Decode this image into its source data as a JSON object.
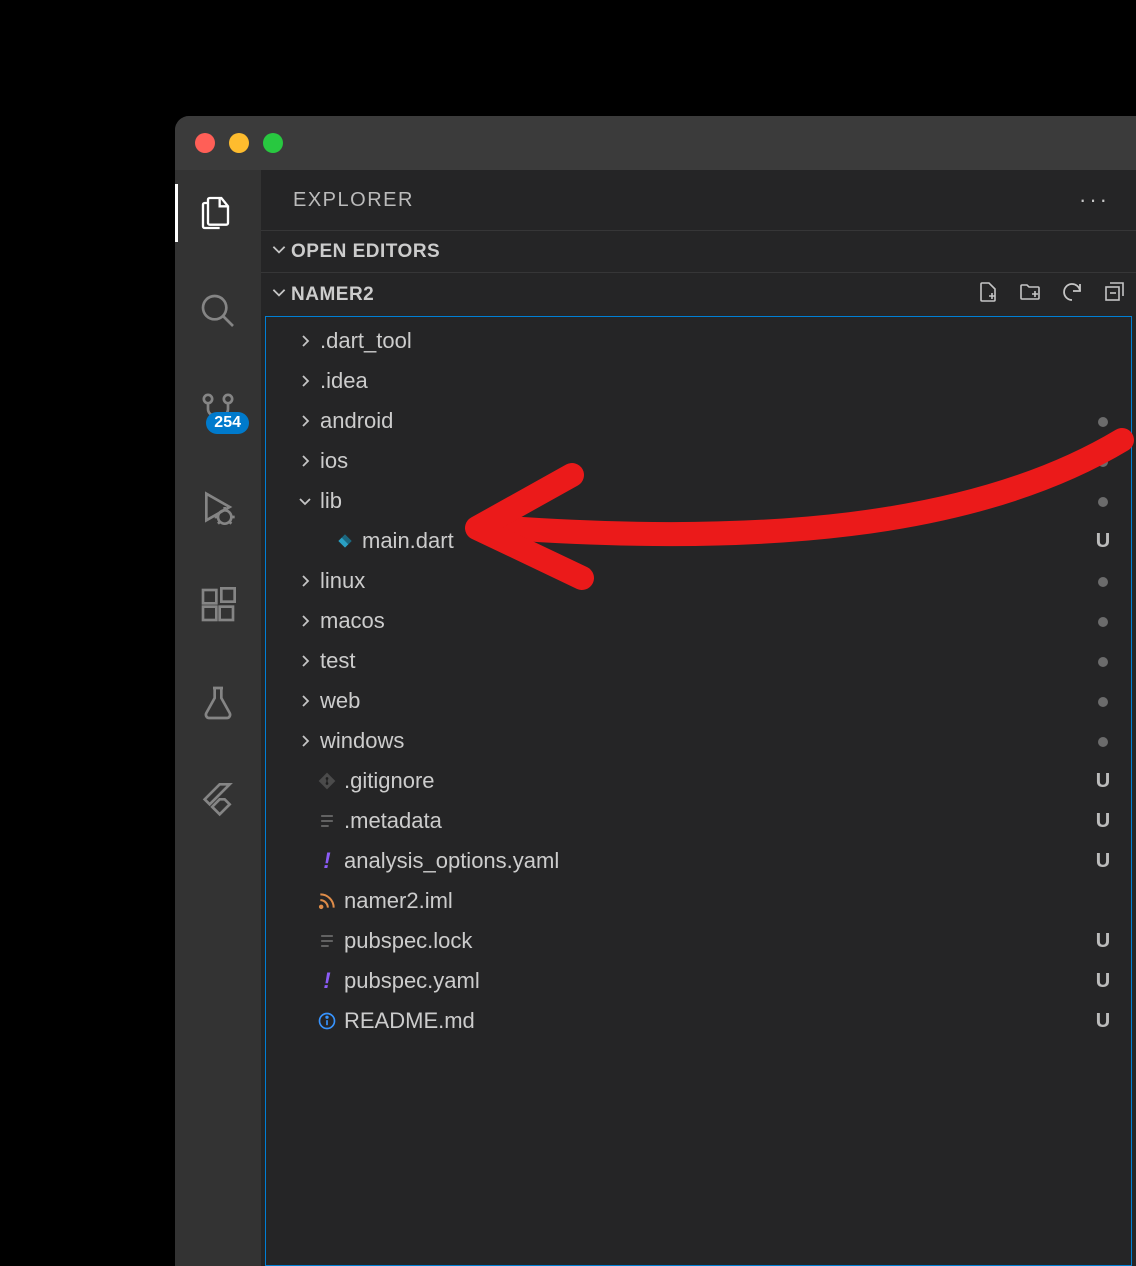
{
  "explorer": {
    "title": "EXPLORER"
  },
  "sections": {
    "open_editors": "OPEN EDITORS",
    "workspace": "NAMER2"
  },
  "activity": {
    "scm_badge": "254"
  },
  "tree": [
    {
      "type": "folder",
      "name": ".dart_tool",
      "expanded": false,
      "status": ""
    },
    {
      "type": "folder",
      "name": ".idea",
      "expanded": false,
      "status": ""
    },
    {
      "type": "folder",
      "name": "android",
      "expanded": false,
      "status": "dot"
    },
    {
      "type": "folder",
      "name": "ios",
      "expanded": false,
      "status": "dot"
    },
    {
      "type": "folder",
      "name": "lib",
      "expanded": true,
      "status": "dot"
    },
    {
      "type": "file",
      "name": "main.dart",
      "icon": "dart",
      "indent": 2,
      "status": "U"
    },
    {
      "type": "folder",
      "name": "linux",
      "expanded": false,
      "status": "dot"
    },
    {
      "type": "folder",
      "name": "macos",
      "expanded": false,
      "status": "dot"
    },
    {
      "type": "folder",
      "name": "test",
      "expanded": false,
      "status": "dot"
    },
    {
      "type": "folder",
      "name": "web",
      "expanded": false,
      "status": "dot"
    },
    {
      "type": "folder",
      "name": "windows",
      "expanded": false,
      "status": "dot"
    },
    {
      "type": "file",
      "name": ".gitignore",
      "icon": "git",
      "indent": 1,
      "status": "U"
    },
    {
      "type": "file",
      "name": ".metadata",
      "icon": "lines",
      "indent": 1,
      "status": "U"
    },
    {
      "type": "file",
      "name": "analysis_options.yaml",
      "icon": "excl",
      "indent": 1,
      "status": "U"
    },
    {
      "type": "file",
      "name": "namer2.iml",
      "icon": "rss",
      "indent": 1,
      "status": ""
    },
    {
      "type": "file",
      "name": "pubspec.lock",
      "icon": "lines",
      "indent": 1,
      "status": "U"
    },
    {
      "type": "file",
      "name": "pubspec.yaml",
      "icon": "excl",
      "indent": 1,
      "status": "U"
    },
    {
      "type": "file",
      "name": "README.md",
      "icon": "info",
      "indent": 1,
      "status": "U"
    }
  ]
}
